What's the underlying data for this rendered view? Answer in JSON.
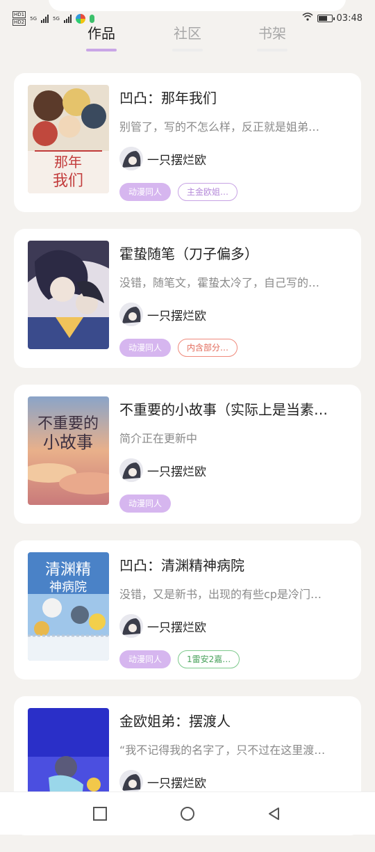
{
  "status_bar": {
    "time": "03:48",
    "network_1": "5G",
    "network_2": "5G",
    "sim_1": "HD1",
    "sim_2": "HD2"
  },
  "tabs": [
    {
      "label": "作品",
      "active": true
    },
    {
      "label": "社区",
      "active": false
    },
    {
      "label": "书架",
      "active": false
    }
  ],
  "works": [
    {
      "title": "凹凸：那年我们",
      "description": "别管了，写的不怎么样，反正就是姐弟…",
      "author": "一只摆烂欧",
      "tags": [
        {
          "label": "动漫同人",
          "style": "filled"
        },
        {
          "label": "主金欧姐…",
          "style": "outline-purple"
        }
      ]
    },
    {
      "title": "霍蛰随笔（刀子偏多）",
      "description": "没错，随笔文，霍蛰太冷了，自己写的…",
      "author": "一只摆烂欧",
      "tags": [
        {
          "label": "动漫同人",
          "style": "filled"
        },
        {
          "label": "内含部分…",
          "style": "outline-red"
        }
      ]
    },
    {
      "title": "不重要的小故事（实际上是当素…",
      "description": "简介正在更新中",
      "author": "一只摆烂欧",
      "tags": [
        {
          "label": "动漫同人",
          "style": "filled"
        }
      ]
    },
    {
      "title": "凹凸：清渊精神病院",
      "description": "没错，又是新书，出现的有些cp是冷门…",
      "author": "一只摆烂欧",
      "tags": [
        {
          "label": "动漫同人",
          "style": "filled"
        },
        {
          "label": "1雷安2嘉…",
          "style": "outline-green"
        }
      ]
    },
    {
      "title": "金欧姐弟：摆渡人",
      "description": "“我不记得我的名字了，只不过在这里渡…",
      "author": "一只摆烂欧",
      "tags": []
    }
  ],
  "colors": {
    "accent": "#c9a6e6",
    "tag_fill": "#d6b6ef",
    "background": "#f4f2ef"
  },
  "nav_icons": [
    "recents-square-icon",
    "home-circle-icon",
    "back-triangle-icon"
  ]
}
